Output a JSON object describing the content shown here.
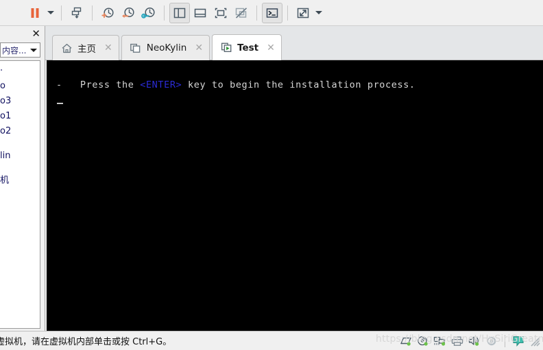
{
  "toolbar": {
    "items": [
      {
        "name": "pause-button",
        "icon": "pause-icon",
        "label": "Pause",
        "active": false
      },
      {
        "name": "pause-dropdown",
        "icon": "caret-down-icon",
        "label": "Power options",
        "active": false
      },
      {
        "name": "send-key-button",
        "icon": "send-key-icon",
        "label": "Send key",
        "active": false
      },
      {
        "name": "take-snapshot-button",
        "icon": "snapshot-add-icon",
        "label": "Take snapshot",
        "active": false
      },
      {
        "name": "revert-snapshot-button",
        "icon": "snapshot-revert-icon",
        "label": "Revert to snapshot",
        "active": false
      },
      {
        "name": "snapshot-manager-button",
        "icon": "snapshot-manage-icon",
        "label": "Manage snapshots",
        "active": false
      },
      {
        "name": "show-library-button",
        "icon": "panel-left-icon",
        "label": "Show library",
        "active": true
      },
      {
        "name": "show-thumbnail-bar-button",
        "icon": "panel-bottom-icon",
        "label": "Show thumbnail bar",
        "active": false
      },
      {
        "name": "full-screen-button",
        "icon": "fullscreen-icon",
        "label": "Full screen",
        "active": false
      },
      {
        "name": "unity-mode-button",
        "icon": "unity-off-icon",
        "label": "Unity mode",
        "active": false
      },
      {
        "name": "console-button",
        "icon": "console-prompt-icon",
        "label": "Console",
        "active": true
      },
      {
        "name": "stretch-button",
        "icon": "stretch-arrows-icon",
        "label": "Stretch guest",
        "active": false
      },
      {
        "name": "stretch-dropdown",
        "icon": "caret-down-icon",
        "label": "Display options",
        "active": false
      }
    ],
    "accent_orange": "#e8633a",
    "accent_teal": "#2aa7bf",
    "icon_stroke": "#4a5a66"
  },
  "sidebar": {
    "close_label": "✕",
    "search": {
      "value": "内容...",
      "placeholder": "输入搜索内容..."
    },
    "items": [
      {
        "label": "·",
        "cn": false
      },
      {
        "label": "o",
        "cn": false
      },
      {
        "label": "o3",
        "cn": false
      },
      {
        "label": "o1",
        "cn": false
      },
      {
        "label": "o2",
        "cn": false
      },
      {
        "label": "lin",
        "cn": false,
        "gap": true
      },
      {
        "label": "机",
        "cn": true,
        "gap": true
      }
    ]
  },
  "tabs": [
    {
      "name": "tab-home",
      "icon": "home-icon",
      "label": "主页",
      "active": false,
      "close": "✕"
    },
    {
      "name": "tab-neokylin",
      "icon": "window-stack-icon",
      "label": "NeoKylin",
      "active": false,
      "close": "✕"
    },
    {
      "name": "tab-test",
      "icon": "vm-running-icon",
      "label": "Test",
      "active": true,
      "close": "✕"
    }
  ],
  "terminal": {
    "background": "#000000",
    "foreground": "#d6d6d6",
    "key_color": "#2b2bd6",
    "lines": [
      {
        "prefix": "-   Press the ",
        "key": "<ENTER>",
        "suffix": " key to begin the installation process."
      }
    ],
    "cursor": "_"
  },
  "statusbar": {
    "message": "虚拟机，请在虚拟机内部单击或按 Ctrl+G。",
    "devices": [
      {
        "name": "hard-disk-icon",
        "label": "Hard Disk",
        "connected": true
      },
      {
        "name": "cd-dvd-icon",
        "label": "CD/DVD",
        "connected": true
      },
      {
        "name": "network-adapter-icon",
        "label": "Network Adapter",
        "connected": true
      },
      {
        "name": "printer-icon",
        "label": "Printer",
        "connected": false
      },
      {
        "name": "sound-card-icon",
        "label": "Sound Card",
        "connected": true
      },
      {
        "name": "usb-icon",
        "label": "USB Device",
        "connected": false
      }
    ],
    "message_indicator": {
      "name": "message-log-icon",
      "label": "Message log",
      "color": "#3fbfae"
    },
    "grip": {
      "name": "resize-grip",
      "label": "Resize"
    }
  },
  "watermark": {
    "text": "https://blog.csdn.net/HySiriGreatness"
  }
}
